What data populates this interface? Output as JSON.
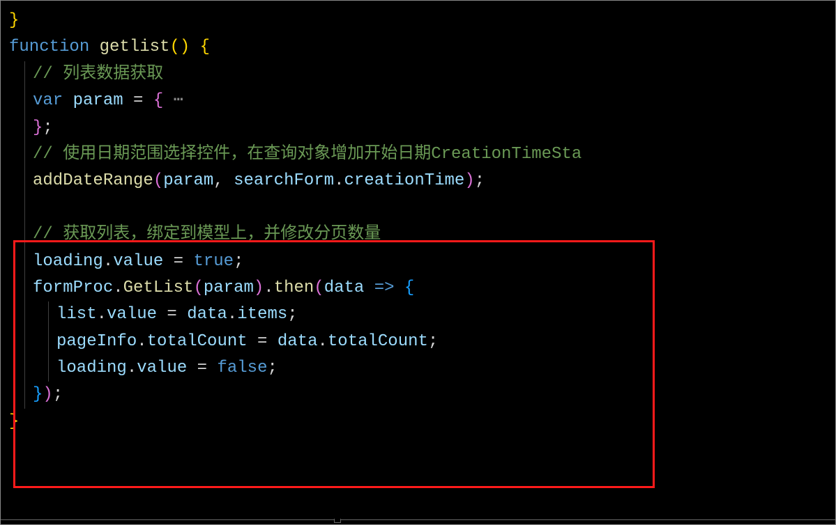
{
  "code": {
    "line0": "}",
    "line1": {
      "fn_kw": "function",
      "name": "getlist",
      "parens": "()",
      "brace": " {"
    },
    "line2": "// 列表数据获取",
    "line3": {
      "var_kw": "var",
      "name": "param",
      "eq": " = ",
      "brace_open": "{",
      "fold": " ⋯"
    },
    "line4": "};",
    "line5": "// 使用日期范围选择控件，在查询对象增加开始日期CreationTimeSta",
    "line6": {
      "fn": "addDateRange",
      "p1": "(",
      "a1": "param",
      "c": ", ",
      "a2_obj": "searchForm",
      "dot": ".",
      "a2_prop": "creationTime",
      "p2": ")",
      "semi": ";"
    },
    "line7": "",
    "line8": "// 获取列表，绑定到模型上，并修改分页数量",
    "line9": {
      "obj": "loading",
      "dot": ".",
      "prop": "value",
      "eq": " = ",
      "val": "true",
      "semi": ";"
    },
    "line10": {
      "obj": "formProc",
      "dot1": ".",
      "m1": "GetList",
      "p1": "(",
      "a1": "param",
      "p2": ")",
      "dot2": ".",
      "m2": "then",
      "p3": "(",
      "a2": "data",
      "arrow": " => ",
      "brace": "{"
    },
    "line11": {
      "obj": "list",
      "dot": ".",
      "prop": "value",
      "eq": " = ",
      "r_obj": "data",
      "r_dot": ".",
      "r_prop": "items",
      "semi": ";"
    },
    "line12": {
      "obj": "pageInfo",
      "dot": ".",
      "prop": "totalCount",
      "eq": " = ",
      "r_obj": "data",
      "r_dot": ".",
      "r_prop": "totalCount",
      "semi": ";"
    },
    "line13": {
      "obj": "loading",
      "dot": ".",
      "prop": "value",
      "eq": " = ",
      "val": "false",
      "semi": ";"
    },
    "line14": {
      "brace": "}",
      "p": ")",
      "semi": ";"
    },
    "line15": "}"
  }
}
